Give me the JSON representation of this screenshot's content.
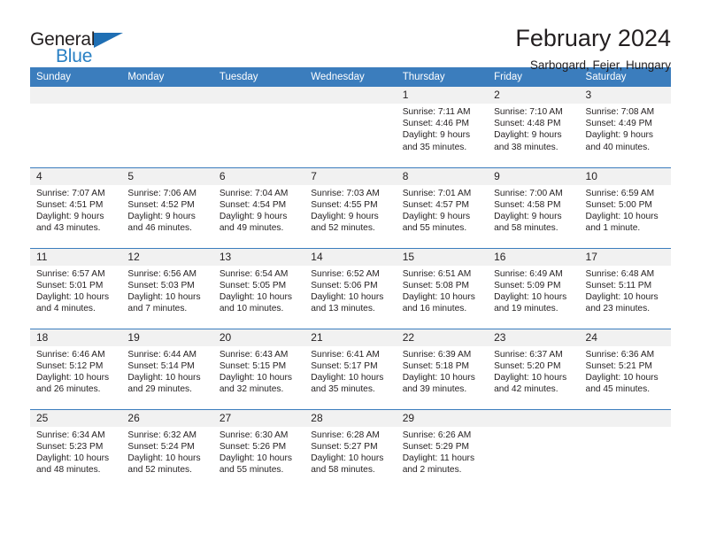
{
  "brand": {
    "name_dark": "General",
    "name_blue": "Blue",
    "accent_color": "#2980c4",
    "triangle_color": "#1f6fb4"
  },
  "header": {
    "title": "February 2024",
    "subtitle": "Sarbogard, Fejer, Hungary"
  },
  "calendar": {
    "header_bg": "#3b7dbd",
    "daynum_bg": "#f1f1f1",
    "weekdays": [
      "Sunday",
      "Monday",
      "Tuesday",
      "Wednesday",
      "Thursday",
      "Friday",
      "Saturday"
    ],
    "weeks": [
      [
        {
          "day": "",
          "sunrise": "",
          "sunset": "",
          "daylight_line1": "",
          "daylight_line2": "",
          "empty": true
        },
        {
          "day": "",
          "sunrise": "",
          "sunset": "",
          "daylight_line1": "",
          "daylight_line2": "",
          "empty": true
        },
        {
          "day": "",
          "sunrise": "",
          "sunset": "",
          "daylight_line1": "",
          "daylight_line2": "",
          "empty": true
        },
        {
          "day": "",
          "sunrise": "",
          "sunset": "",
          "daylight_line1": "",
          "daylight_line2": "",
          "empty": true
        },
        {
          "day": "1",
          "sunrise": "Sunrise: 7:11 AM",
          "sunset": "Sunset: 4:46 PM",
          "daylight_line1": "Daylight: 9 hours",
          "daylight_line2": "and 35 minutes.",
          "empty": false
        },
        {
          "day": "2",
          "sunrise": "Sunrise: 7:10 AM",
          "sunset": "Sunset: 4:48 PM",
          "daylight_line1": "Daylight: 9 hours",
          "daylight_line2": "and 38 minutes.",
          "empty": false
        },
        {
          "day": "3",
          "sunrise": "Sunrise: 7:08 AM",
          "sunset": "Sunset: 4:49 PM",
          "daylight_line1": "Daylight: 9 hours",
          "daylight_line2": "and 40 minutes.",
          "empty": false
        }
      ],
      [
        {
          "day": "4",
          "sunrise": "Sunrise: 7:07 AM",
          "sunset": "Sunset: 4:51 PM",
          "daylight_line1": "Daylight: 9 hours",
          "daylight_line2": "and 43 minutes.",
          "empty": false
        },
        {
          "day": "5",
          "sunrise": "Sunrise: 7:06 AM",
          "sunset": "Sunset: 4:52 PM",
          "daylight_line1": "Daylight: 9 hours",
          "daylight_line2": "and 46 minutes.",
          "empty": false
        },
        {
          "day": "6",
          "sunrise": "Sunrise: 7:04 AM",
          "sunset": "Sunset: 4:54 PM",
          "daylight_line1": "Daylight: 9 hours",
          "daylight_line2": "and 49 minutes.",
          "empty": false
        },
        {
          "day": "7",
          "sunrise": "Sunrise: 7:03 AM",
          "sunset": "Sunset: 4:55 PM",
          "daylight_line1": "Daylight: 9 hours",
          "daylight_line2": "and 52 minutes.",
          "empty": false
        },
        {
          "day": "8",
          "sunrise": "Sunrise: 7:01 AM",
          "sunset": "Sunset: 4:57 PM",
          "daylight_line1": "Daylight: 9 hours",
          "daylight_line2": "and 55 minutes.",
          "empty": false
        },
        {
          "day": "9",
          "sunrise": "Sunrise: 7:00 AM",
          "sunset": "Sunset: 4:58 PM",
          "daylight_line1": "Daylight: 9 hours",
          "daylight_line2": "and 58 minutes.",
          "empty": false
        },
        {
          "day": "10",
          "sunrise": "Sunrise: 6:59 AM",
          "sunset": "Sunset: 5:00 PM",
          "daylight_line1": "Daylight: 10 hours",
          "daylight_line2": "and 1 minute.",
          "empty": false
        }
      ],
      [
        {
          "day": "11",
          "sunrise": "Sunrise: 6:57 AM",
          "sunset": "Sunset: 5:01 PM",
          "daylight_line1": "Daylight: 10 hours",
          "daylight_line2": "and 4 minutes.",
          "empty": false
        },
        {
          "day": "12",
          "sunrise": "Sunrise: 6:56 AM",
          "sunset": "Sunset: 5:03 PM",
          "daylight_line1": "Daylight: 10 hours",
          "daylight_line2": "and 7 minutes.",
          "empty": false
        },
        {
          "day": "13",
          "sunrise": "Sunrise: 6:54 AM",
          "sunset": "Sunset: 5:05 PM",
          "daylight_line1": "Daylight: 10 hours",
          "daylight_line2": "and 10 minutes.",
          "empty": false
        },
        {
          "day": "14",
          "sunrise": "Sunrise: 6:52 AM",
          "sunset": "Sunset: 5:06 PM",
          "daylight_line1": "Daylight: 10 hours",
          "daylight_line2": "and 13 minutes.",
          "empty": false
        },
        {
          "day": "15",
          "sunrise": "Sunrise: 6:51 AM",
          "sunset": "Sunset: 5:08 PM",
          "daylight_line1": "Daylight: 10 hours",
          "daylight_line2": "and 16 minutes.",
          "empty": false
        },
        {
          "day": "16",
          "sunrise": "Sunrise: 6:49 AM",
          "sunset": "Sunset: 5:09 PM",
          "daylight_line1": "Daylight: 10 hours",
          "daylight_line2": "and 19 minutes.",
          "empty": false
        },
        {
          "day": "17",
          "sunrise": "Sunrise: 6:48 AM",
          "sunset": "Sunset: 5:11 PM",
          "daylight_line1": "Daylight: 10 hours",
          "daylight_line2": "and 23 minutes.",
          "empty": false
        }
      ],
      [
        {
          "day": "18",
          "sunrise": "Sunrise: 6:46 AM",
          "sunset": "Sunset: 5:12 PM",
          "daylight_line1": "Daylight: 10 hours",
          "daylight_line2": "and 26 minutes.",
          "empty": false
        },
        {
          "day": "19",
          "sunrise": "Sunrise: 6:44 AM",
          "sunset": "Sunset: 5:14 PM",
          "daylight_line1": "Daylight: 10 hours",
          "daylight_line2": "and 29 minutes.",
          "empty": false
        },
        {
          "day": "20",
          "sunrise": "Sunrise: 6:43 AM",
          "sunset": "Sunset: 5:15 PM",
          "daylight_line1": "Daylight: 10 hours",
          "daylight_line2": "and 32 minutes.",
          "empty": false
        },
        {
          "day": "21",
          "sunrise": "Sunrise: 6:41 AM",
          "sunset": "Sunset: 5:17 PM",
          "daylight_line1": "Daylight: 10 hours",
          "daylight_line2": "and 35 minutes.",
          "empty": false
        },
        {
          "day": "22",
          "sunrise": "Sunrise: 6:39 AM",
          "sunset": "Sunset: 5:18 PM",
          "daylight_line1": "Daylight: 10 hours",
          "daylight_line2": "and 39 minutes.",
          "empty": false
        },
        {
          "day": "23",
          "sunrise": "Sunrise: 6:37 AM",
          "sunset": "Sunset: 5:20 PM",
          "daylight_line1": "Daylight: 10 hours",
          "daylight_line2": "and 42 minutes.",
          "empty": false
        },
        {
          "day": "24",
          "sunrise": "Sunrise: 6:36 AM",
          "sunset": "Sunset: 5:21 PM",
          "daylight_line1": "Daylight: 10 hours",
          "daylight_line2": "and 45 minutes.",
          "empty": false
        }
      ],
      [
        {
          "day": "25",
          "sunrise": "Sunrise: 6:34 AM",
          "sunset": "Sunset: 5:23 PM",
          "daylight_line1": "Daylight: 10 hours",
          "daylight_line2": "and 48 minutes.",
          "empty": false
        },
        {
          "day": "26",
          "sunrise": "Sunrise: 6:32 AM",
          "sunset": "Sunset: 5:24 PM",
          "daylight_line1": "Daylight: 10 hours",
          "daylight_line2": "and 52 minutes.",
          "empty": false
        },
        {
          "day": "27",
          "sunrise": "Sunrise: 6:30 AM",
          "sunset": "Sunset: 5:26 PM",
          "daylight_line1": "Daylight: 10 hours",
          "daylight_line2": "and 55 minutes.",
          "empty": false
        },
        {
          "day": "28",
          "sunrise": "Sunrise: 6:28 AM",
          "sunset": "Sunset: 5:27 PM",
          "daylight_line1": "Daylight: 10 hours",
          "daylight_line2": "and 58 minutes.",
          "empty": false
        },
        {
          "day": "29",
          "sunrise": "Sunrise: 6:26 AM",
          "sunset": "Sunset: 5:29 PM",
          "daylight_line1": "Daylight: 11 hours",
          "daylight_line2": "and 2 minutes.",
          "empty": false
        },
        {
          "day": "",
          "sunrise": "",
          "sunset": "",
          "daylight_line1": "",
          "daylight_line2": "",
          "empty": true
        },
        {
          "day": "",
          "sunrise": "",
          "sunset": "",
          "daylight_line1": "",
          "daylight_line2": "",
          "empty": true
        }
      ]
    ]
  }
}
